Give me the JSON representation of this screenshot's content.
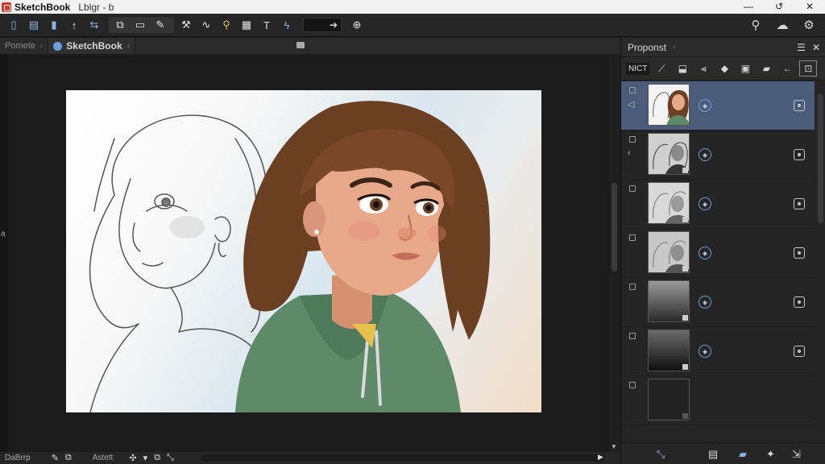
{
  "titlebar": {
    "app_name": "SketchBook",
    "doc_name": "Lblgr - b",
    "minimize": "—",
    "restore": "↺",
    "close": "✕"
  },
  "toolbar": {
    "field_value": "➔",
    "icons": [
      "new-file-icon",
      "open-file-icon",
      "save-icon",
      "brush-icon",
      "transform-icon",
      "selection-group-icon",
      "pen-icon",
      "symmetry-icon",
      "curve-icon",
      "zoom-icon",
      "texture-icon",
      "text-icon",
      "lightning-icon",
      "pin-icon",
      "search-icon",
      "cloud-icon",
      "settings-icon"
    ]
  },
  "tabs": [
    {
      "label": "Pomete",
      "active": false
    },
    {
      "label": "SketchBook",
      "active": true
    }
  ],
  "canvas": {
    "left_strip_label": "a"
  },
  "statusbar": {
    "left_label": "DaBrrp",
    "mid_label": "Astett"
  },
  "panel": {
    "title": "Proponst",
    "tool_label": "NICT",
    "layers": [
      {
        "selected": true,
        "kind": "color"
      },
      {
        "selected": false,
        "kind": "sketch"
      },
      {
        "selected": false,
        "kind": "sketch-light"
      },
      {
        "selected": false,
        "kind": "sketch-light"
      },
      {
        "selected": false,
        "kind": "gradient"
      },
      {
        "selected": false,
        "kind": "gradient-dark"
      },
      {
        "selected": false,
        "kind": "empty"
      }
    ]
  },
  "colors": {
    "accent": "#4a5c7a",
    "icon_blue": "#8fb6e6",
    "hair": "#6b3f22",
    "hoodie": "#5f8a6a",
    "skin": "#e8a98a"
  }
}
